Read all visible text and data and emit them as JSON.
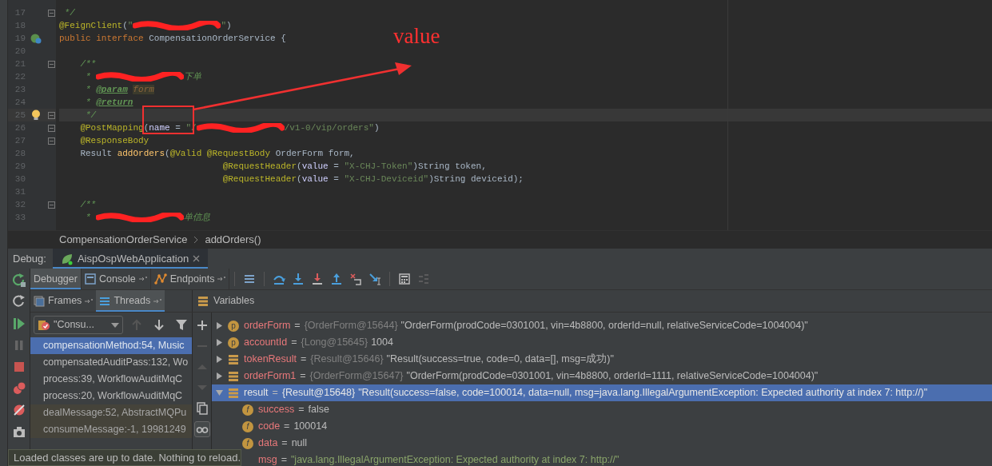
{
  "editor": {
    "lines": [
      {
        "number": "17",
        "kind": "plain",
        "fold": true,
        "segments": [
          {
            "kind": "comment",
            "text": " */"
          }
        ]
      },
      {
        "number": "18",
        "kind": "plain",
        "fold": false,
        "segments": [
          {
            "kind": "annotation",
            "text": "@FeignClient"
          },
          {
            "kind": "plain",
            "text": "("
          },
          {
            "kind": "string",
            "text": "\""
          },
          {
            "kind": "redacted"
          },
          {
            "kind": "string",
            "text": "\""
          },
          {
            "kind": "plain",
            "text": ")"
          }
        ]
      },
      {
        "number": "19",
        "kind": "interface",
        "fold": false,
        "segments": [
          {
            "kind": "keyword",
            "text": "public interface "
          },
          {
            "kind": "plain",
            "text": "CompensationOrderService {"
          }
        ]
      },
      {
        "number": "20",
        "kind": "plain",
        "fold": false
      },
      {
        "number": "21",
        "kind": "plain",
        "fold": true,
        "segments": [
          {
            "kind": "comment",
            "text": "    /**"
          }
        ]
      },
      {
        "number": "22",
        "kind": "plain",
        "fold": false,
        "segments": [
          {
            "kind": "comment",
            "text": "     * "
          },
          {
            "kind": "redacted"
          },
          {
            "kind": "comment",
            "text": "下单"
          }
        ]
      },
      {
        "number": "23",
        "kind": "plain",
        "fold": false,
        "segments": [
          {
            "kind": "comment",
            "text": "     * "
          },
          {
            "kind": "doc_tag",
            "text": "@param"
          },
          {
            "kind": "doc_param",
            "text": " form"
          }
        ]
      },
      {
        "number": "24",
        "kind": "plain",
        "fold": false,
        "segments": [
          {
            "kind": "comment",
            "text": "     * "
          },
          {
            "kind": "doc_tag",
            "text": "@return"
          }
        ]
      },
      {
        "number": "25",
        "kind": "bulb",
        "fold": true,
        "current": true,
        "segments": [
          {
            "kind": "comment",
            "text": "     */"
          }
        ]
      },
      {
        "number": "26",
        "kind": "plain",
        "fold": true,
        "segments": [
          {
            "kind": "annotation",
            "text": "    @PostMapping"
          },
          {
            "kind": "plain",
            "text": "("
          },
          {
            "kind": "named_arg",
            "text": "name"
          },
          {
            "kind": "plain",
            "text": " = "
          },
          {
            "kind": "string",
            "text": "\"/"
          },
          {
            "kind": "redacted"
          },
          {
            "kind": "string",
            "text": "/v1-0/vip/orders\""
          },
          {
            "kind": "plain",
            "text": ")"
          }
        ]
      },
      {
        "number": "27",
        "kind": "plain",
        "fold": true,
        "segments": [
          {
            "kind": "annotation",
            "text": "    @ResponseBody"
          }
        ]
      },
      {
        "number": "28",
        "kind": "plain",
        "fold": false,
        "segments": [
          {
            "kind": "plain",
            "text": "    Result "
          },
          {
            "kind": "method",
            "text": "addOrders"
          },
          {
            "kind": "plain",
            "text": "("
          },
          {
            "kind": "annotation",
            "text": "@Valid @RequestBody"
          },
          {
            "kind": "plain",
            "text": " OrderForm form,"
          }
        ]
      },
      {
        "number": "29",
        "kind": "plain",
        "fold": false,
        "segments": [
          {
            "kind": "annotation",
            "text": "                               @RequestHeader"
          },
          {
            "kind": "plain",
            "text": "("
          },
          {
            "kind": "named_arg",
            "text": "value"
          },
          {
            "kind": "plain",
            "text": " = "
          },
          {
            "kind": "string",
            "text": "\"X-CHJ-Token\""
          },
          {
            "kind": "plain",
            "text": ")String token,"
          }
        ]
      },
      {
        "number": "30",
        "kind": "plain",
        "fold": false,
        "segments": [
          {
            "kind": "annotation",
            "text": "                               @RequestHeader"
          },
          {
            "kind": "plain",
            "text": "("
          },
          {
            "kind": "named_arg",
            "text": "value"
          },
          {
            "kind": "plain",
            "text": " = "
          },
          {
            "kind": "string",
            "text": "\"X-CHJ-Deviceid\""
          },
          {
            "kind": "plain",
            "text": ")String deviceid);"
          }
        ]
      },
      {
        "number": "31",
        "kind": "plain",
        "fold": false
      },
      {
        "number": "32",
        "kind": "plain",
        "fold": true,
        "segments": [
          {
            "kind": "comment",
            "text": "    /**"
          }
        ]
      },
      {
        "number": "33",
        "kind": "plain",
        "fold": false,
        "segments": [
          {
            "kind": "comment",
            "text": "     * "
          },
          {
            "kind": "redacted"
          },
          {
            "kind": "comment",
            "text": "单信息"
          }
        ]
      }
    ],
    "annotation": {
      "label": "value"
    }
  },
  "breadcrumbs": [
    "CompensationOrderService",
    "addOrders()"
  ],
  "debug": {
    "label": "Debug:",
    "tabs": [
      {
        "label": "AispOspWebApplication",
        "selected": true
      }
    ]
  },
  "toolbar_tabs": [
    {
      "label": "Debugger",
      "selected": true,
      "kind": "plain"
    },
    {
      "label": "Console",
      "selected": false,
      "kind": "console"
    },
    {
      "label": "Endpoints",
      "selected": false,
      "kind": "endpoints"
    }
  ],
  "frame_tabs": [
    {
      "label": "Frames",
      "selected": false
    },
    {
      "label": "Threads",
      "selected": true
    }
  ],
  "variables_title": "Variables",
  "thread_dropdown": {
    "value": "\"Consu..."
  },
  "frames": [
    {
      "text": "compensationMethod:54, Music",
      "selected": true,
      "kind": "app"
    },
    {
      "text": "compensatedAuditPass:132, Wo",
      "selected": false,
      "kind": "app"
    },
    {
      "text": "process:39, WorkflowAuditMqC",
      "selected": false,
      "kind": "app"
    },
    {
      "text": "process:20, WorkflowAuditMqC",
      "selected": false,
      "kind": "app"
    },
    {
      "text": "dealMessage:52, AbstractMQPu",
      "selected": false,
      "kind": "library"
    },
    {
      "text": "consumeMessage:-1, 19981249",
      "selected": false,
      "kind": "library"
    }
  ],
  "variables": [
    {
      "kind": "param",
      "badge": "p",
      "name": "orderForm",
      "separator": "=",
      "type": "{OrderForm@15644}",
      "value": "\"OrderForm(prodCode=0301001, vin=4b8800, orderId=null, relativeServiceCode=1004004)\"",
      "expanded": false,
      "selected": false
    },
    {
      "kind": "param",
      "badge": "p",
      "name": "accountId",
      "separator": "=",
      "type": "{Long@15645}",
      "value": "1004",
      "expanded": false,
      "selected": false
    },
    {
      "kind": "local",
      "name": "tokenResult",
      "separator": "=",
      "type": "{Result@15646}",
      "value": "\"Result(success=true, code=0, data=[], msg=成功)\"",
      "expanded": false,
      "selected": false
    },
    {
      "kind": "local",
      "name": "orderForm1",
      "separator": "=",
      "type": "{OrderForm@15647}",
      "value": "\"OrderForm(prodCode=0301001, vin=4b8800, orderId=1111, relativeServiceCode=1004004)\"",
      "expanded": false,
      "selected": false
    },
    {
      "kind": "local",
      "name": "result",
      "separator": "=",
      "type": "{Result@15648}",
      "value": "\"Result(success=false, code=100014, data=null, msg=java.lang.IllegalArgumentException: Expected authority at index 7: http://)\"",
      "expanded": true,
      "selected": true,
      "children": [
        {
          "kind": "field",
          "badge": "f",
          "name": "success",
          "separator": "=",
          "value": "false"
        },
        {
          "kind": "field",
          "badge": "f",
          "name": "code",
          "separator": "=",
          "value": "100014"
        },
        {
          "kind": "field",
          "badge": "f",
          "name": "data",
          "separator": "=",
          "value": "null"
        },
        {
          "kind": "string_field",
          "name": "msg",
          "separator": "=",
          "value": "\"java.lang.IllegalArgumentException: Expected authority at index 7: http://\""
        }
      ]
    }
  ],
  "notification": "Loaded classes are up to date. Nothing to reload."
}
